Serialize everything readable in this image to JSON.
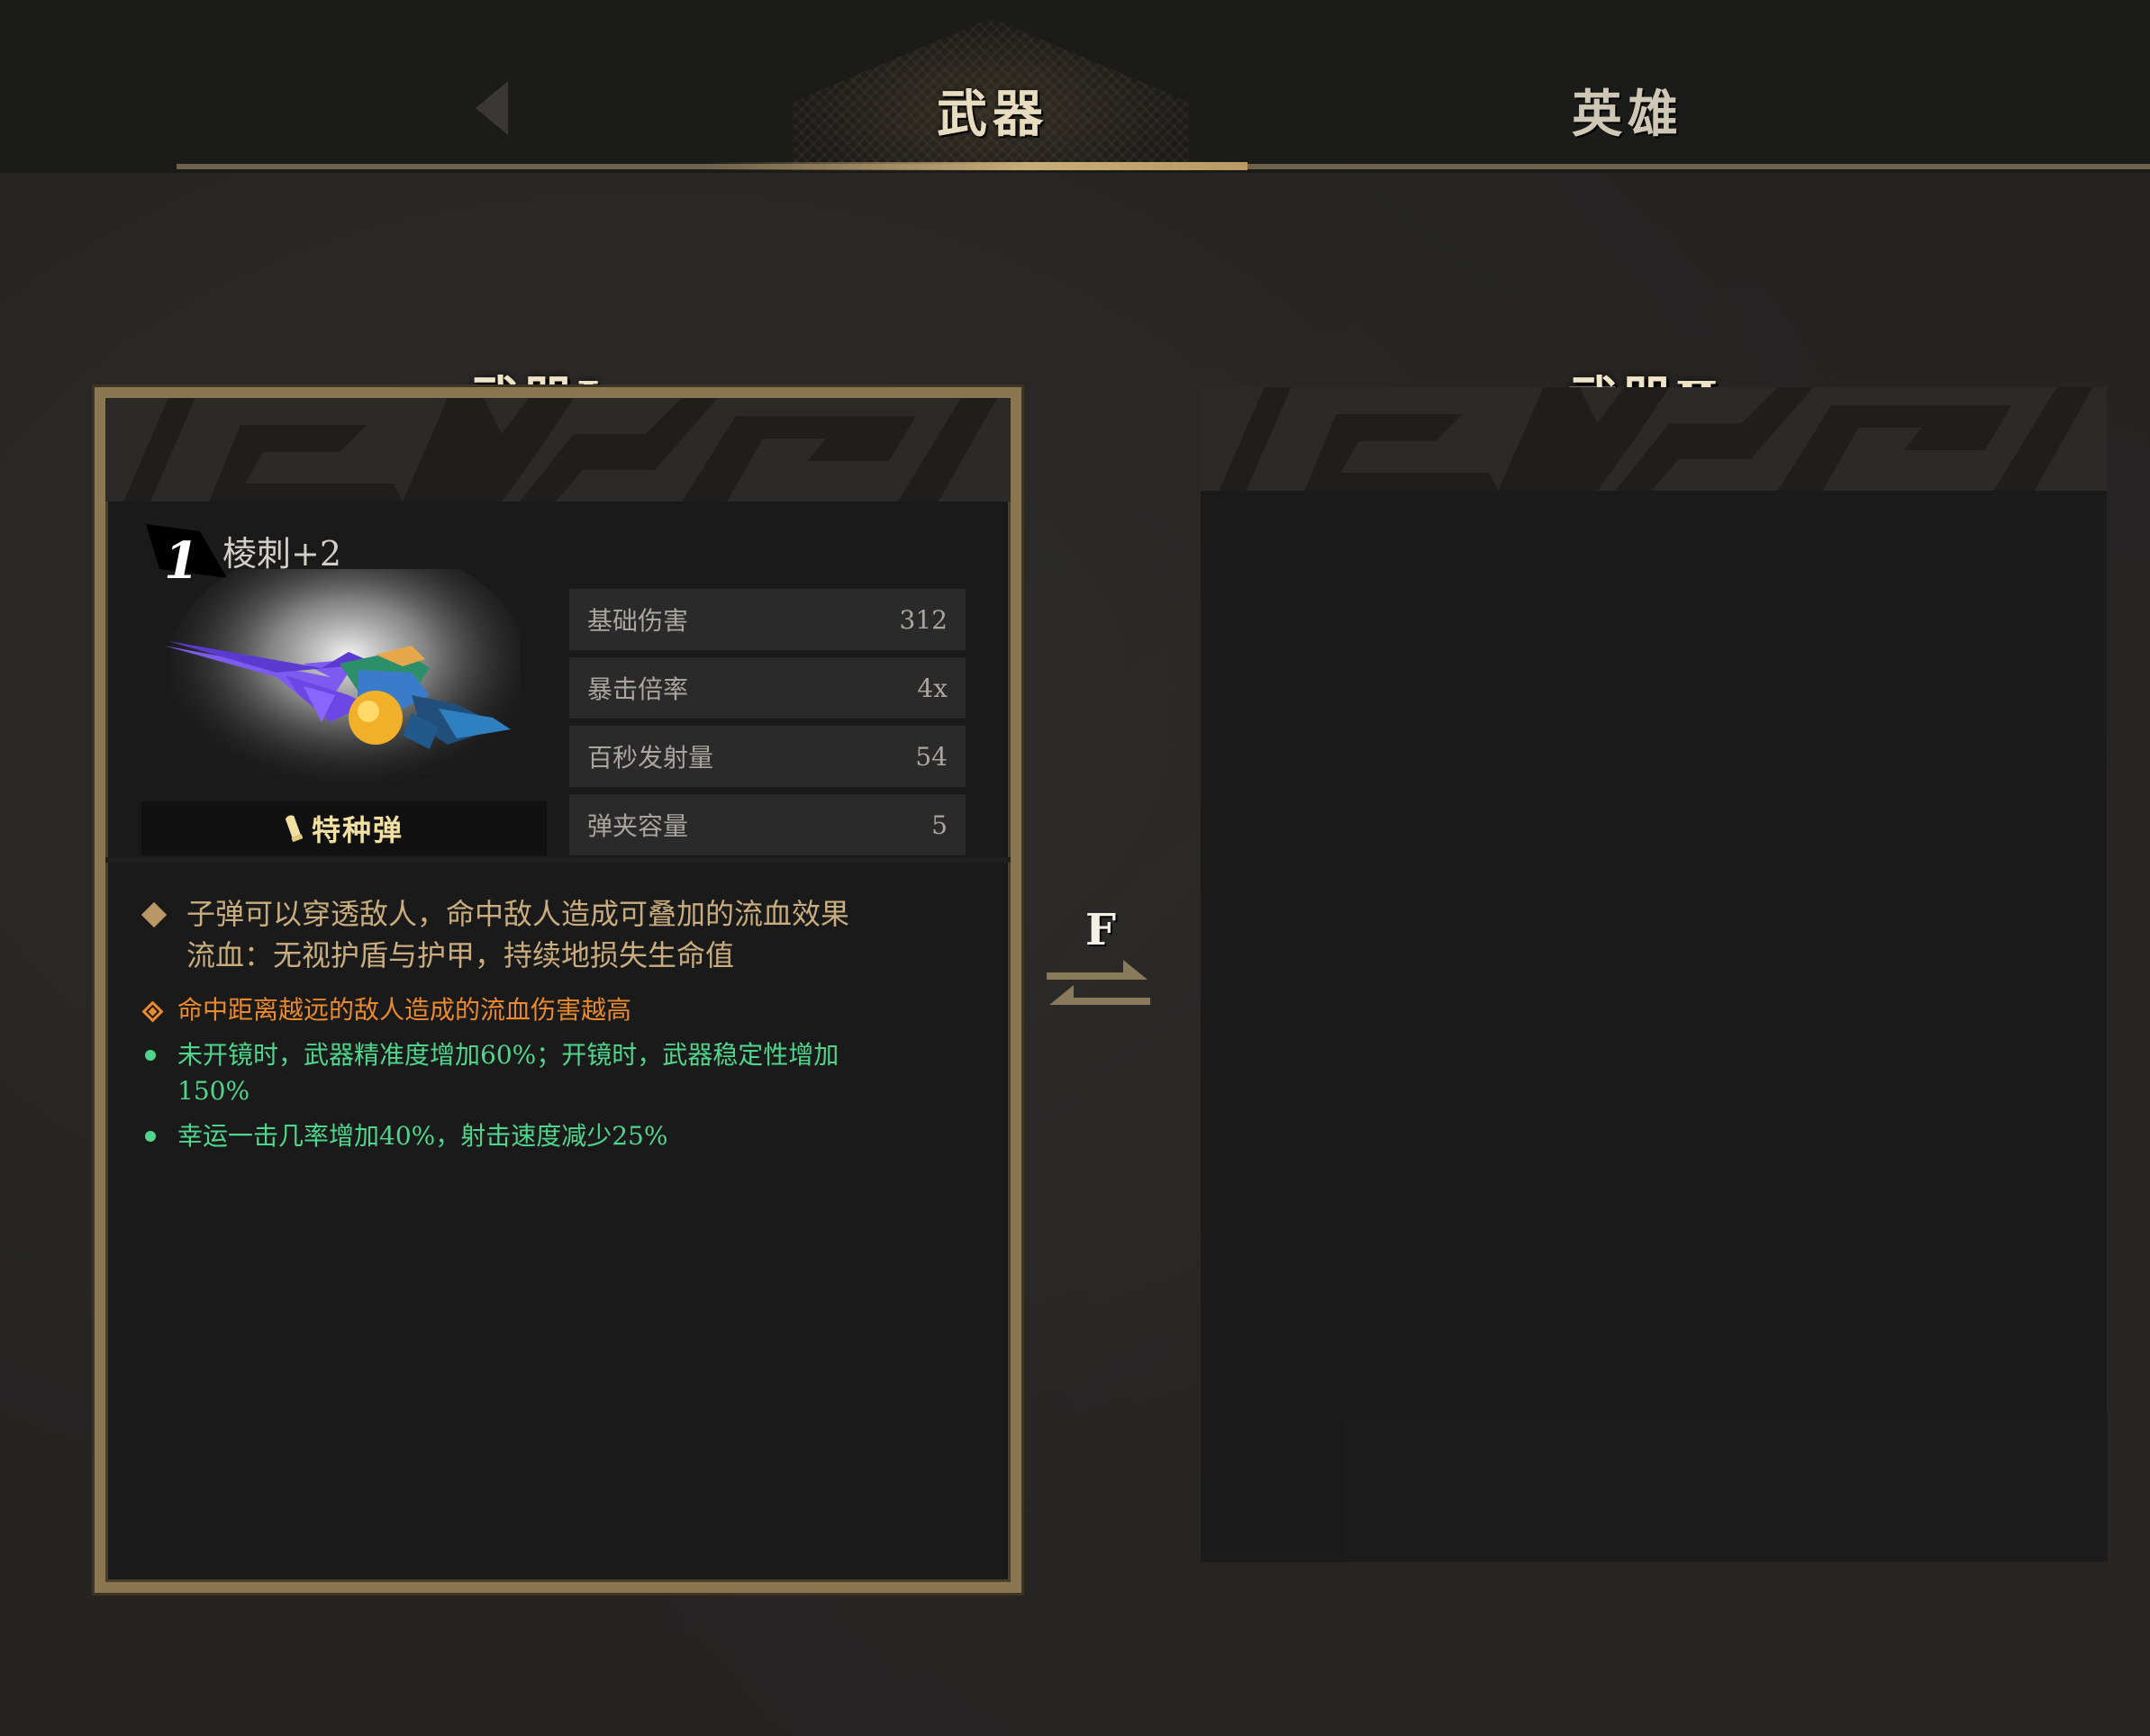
{
  "tabs": {
    "active": "武器",
    "inactive": "英雄"
  },
  "panel1": {
    "title": "武器Ⅰ",
    "rank": "1",
    "weapon_name": "棱刺+2",
    "ammo_type": "特种弹",
    "stats": [
      {
        "label": "基础伤害",
        "value": "312"
      },
      {
        "label": "暴击倍率",
        "value": "4x"
      },
      {
        "label": "百秒发射量",
        "value": "54"
      },
      {
        "label": "弹夹容量",
        "value": "5"
      }
    ],
    "description": {
      "line1": "子弹可以穿透敌人，命中敌人造成可叠加的流血效果",
      "line2": "流血：无视护盾与护甲，持续地损失生命值"
    },
    "modifiers": {
      "orange": "命中距离越远的敌人造成的流血伤害越高",
      "green1": "未开镜时，武器精准度增加60%；开镜时，武器稳定性增加150%",
      "green2": "幸运一击几率增加40%，射击速度减少25%"
    }
  },
  "panel2": {
    "title": "武器Ⅱ"
  },
  "swap": {
    "key": "F"
  },
  "colors": {
    "gold": "#c9ad78",
    "orange": "#e98a2c",
    "green": "#4fd68c",
    "ammo": "#f2e0a2"
  },
  "icons": {
    "back": "back-arrow-icon",
    "ammo": "bullet-icon",
    "swap": "swap-arrows-icon"
  }
}
